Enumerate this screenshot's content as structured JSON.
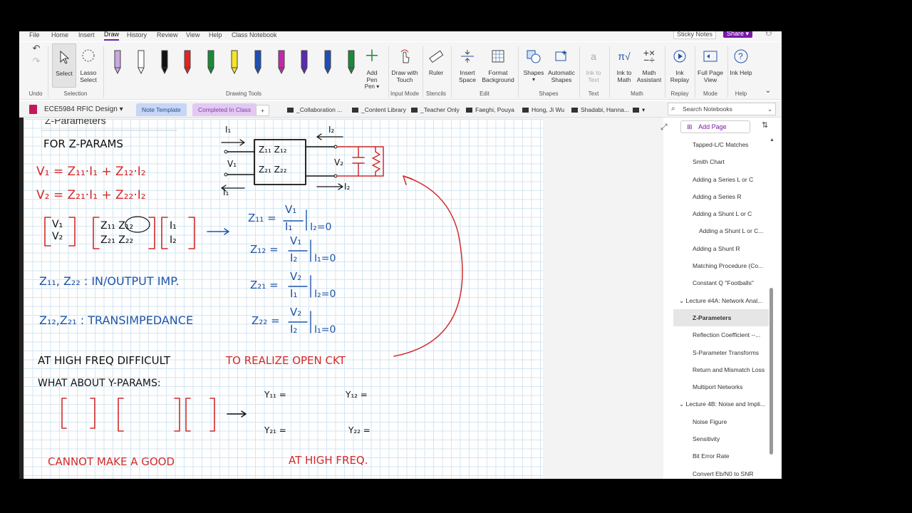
{
  "menu": {
    "items": [
      "File",
      "Home",
      "Insert",
      "Draw",
      "History",
      "Review",
      "View",
      "Help",
      "Class Notebook"
    ],
    "active": "Draw",
    "sticky_notes": "Sticky Notes",
    "share": "Share"
  },
  "ribbon": {
    "undo_group": "Undo",
    "select": "Select",
    "lasso": "Lasso Select",
    "selection_group": "Selection",
    "drawing_tools_group": "Drawing Tools",
    "add_pen": "Add Pen",
    "pens": [
      {
        "color": "#c8a8e0"
      },
      {
        "color": "#ffffff"
      },
      {
        "color": "#111111"
      },
      {
        "color": "#e02424"
      },
      {
        "color": "#1a8a3a"
      },
      {
        "color": "#f5e52a"
      },
      {
        "color": "#1f4fb5"
      },
      {
        "color": "#c02aa8"
      },
      {
        "color": "#5a2ab0"
      },
      {
        "color": "#1f4fb5"
      },
      {
        "color": "#1a8a3a"
      }
    ],
    "draw_with_touch": "Draw with Touch",
    "input_mode_group": "Input Mode",
    "ruler": "Ruler",
    "stencils_group": "Stencils",
    "insert_space": "Insert Space",
    "format_background": "Format Background",
    "edit_group": "Edit",
    "shapes": "Shapes",
    "automatic_shapes": "Automatic Shapes",
    "shapes_group": "Shapes",
    "ink_to_text": "Ink to Text",
    "text_group": "Text",
    "ink_to_math": "Ink to Math",
    "math_assistant": "Math Assistant",
    "math_group": "Math",
    "ink_replay": "Ink Replay",
    "replay_group": "Replay",
    "full_page_view": "Full Page View",
    "mode_group": "Mode",
    "ink_help": "Ink Help",
    "help_group": "Help"
  },
  "tabs": {
    "notebook": "ECE5984 RFIC Design",
    "sections": [
      {
        "label": "Note Template",
        "color": "#c7d6f5",
        "text": "#2b4c8c"
      },
      {
        "label": "Completed In Class",
        "color": "#e3c9f2",
        "text": "#7a3fa6"
      }
    ],
    "add": "+",
    "channels": [
      "_Collaboration ...",
      "_Content Library",
      "_Teacher Only",
      "Faeghi, Pouya",
      "Hong, Ji Wu",
      "Shadabi, Hanna..."
    ],
    "search_placeholder": "Search Notebooks"
  },
  "page": {
    "title": "Z-Parameters"
  },
  "notes": {
    "for_z": "FOR Z-PARAMS",
    "v1": "V₁ = Z₁₁·I₁ + Z₁₂·I₂",
    "v2": "V₂ = Z₂₁·I₁ + Z₂₂·I₂",
    "z11_line": "Z₁₁, Z₂₂ : IN/OUTPUT IMP.",
    "z12_line": "Z₁₂,Z₂₁ : TRANSIMPEDANCE",
    "high_freq_a": "AT HIGH FREQ DIFFICULT",
    "high_freq_b": "TO REALIZE OPEN CKT",
    "y_params": "WHAT ABOUT Y-PARAMS:",
    "cannot": "CANNOT MAKE A GOOD",
    "at_high": "AT HIGH FREQ.",
    "eq_z11": "Z₁₁ =",
    "eq_z12": "Z₁₂ =",
    "eq_z21": "Z₂₁ =",
    "eq_z22": "Z₂₂ =",
    "num_v1": "V₁",
    "num_v2": "V₂",
    "den_i1": "I₁",
    "den_i2": "I₂",
    "cond_i2": "I₂=0",
    "cond_i1": "I₁=0",
    "y11": "Y₁₁ =",
    "y12": "Y₁₂ =",
    "y21": "Y₂₁ =",
    "y22": "Y₂₂ =",
    "box_top": "Z₁₁ Z₁₂",
    "box_bot": "Z₂₁ Z₂₂",
    "mat_v": "V₁\nV₂",
    "mat_z": "Z₁₁ Z₁₂\nZ₂₁ Z₂₂",
    "mat_i": "I₁\nI₂",
    "lbl_I1": "I₁",
    "lbl_I2": "I₂",
    "lbl_V1": "V₁",
    "lbl_V2": "V₂"
  },
  "nav": {
    "add_page": "Add Page",
    "pages": [
      {
        "label": "Tapped-L/C Matches",
        "indent": 1
      },
      {
        "label": "Smith Chart",
        "indent": 1
      },
      {
        "label": "Adding a Series L or C",
        "indent": 1
      },
      {
        "label": "Adding a Series R",
        "indent": 1
      },
      {
        "label": "Adding a Shunt L or C",
        "indent": 1
      },
      {
        "label": "Adding a Shunt L or C...",
        "indent": 2
      },
      {
        "label": "Adding a Shunt R",
        "indent": 1
      },
      {
        "label": "Matching Procedure (Co...",
        "indent": 1
      },
      {
        "label": "Constant Q \"Footballs\"",
        "indent": 1
      },
      {
        "label": "Lecture #4A: Network Anal...",
        "indent": 0,
        "group": true
      },
      {
        "label": "Z-Parameters",
        "indent": 1,
        "active": true
      },
      {
        "label": "Reflection Coefficient --...",
        "indent": 1
      },
      {
        "label": "S-Parameter Transforms",
        "indent": 1
      },
      {
        "label": "Return and Mismatch Loss",
        "indent": 1
      },
      {
        "label": "Multiport Networks",
        "indent": 1
      },
      {
        "label": "Lecture 4B: Noise and Impli...",
        "indent": 0,
        "group": true
      },
      {
        "label": "Noise Figure",
        "indent": 1
      },
      {
        "label": "Sensitivity",
        "indent": 1
      },
      {
        "label": "Bit Error Rate",
        "indent": 1
      },
      {
        "label": "Convert Eb/N0 to SNR",
        "indent": 1
      }
    ]
  },
  "colors": {
    "accent": "#7719aa",
    "ink_black": "#111111",
    "ink_red": "#d22a2a",
    "ink_blue": "#1f55a8"
  }
}
